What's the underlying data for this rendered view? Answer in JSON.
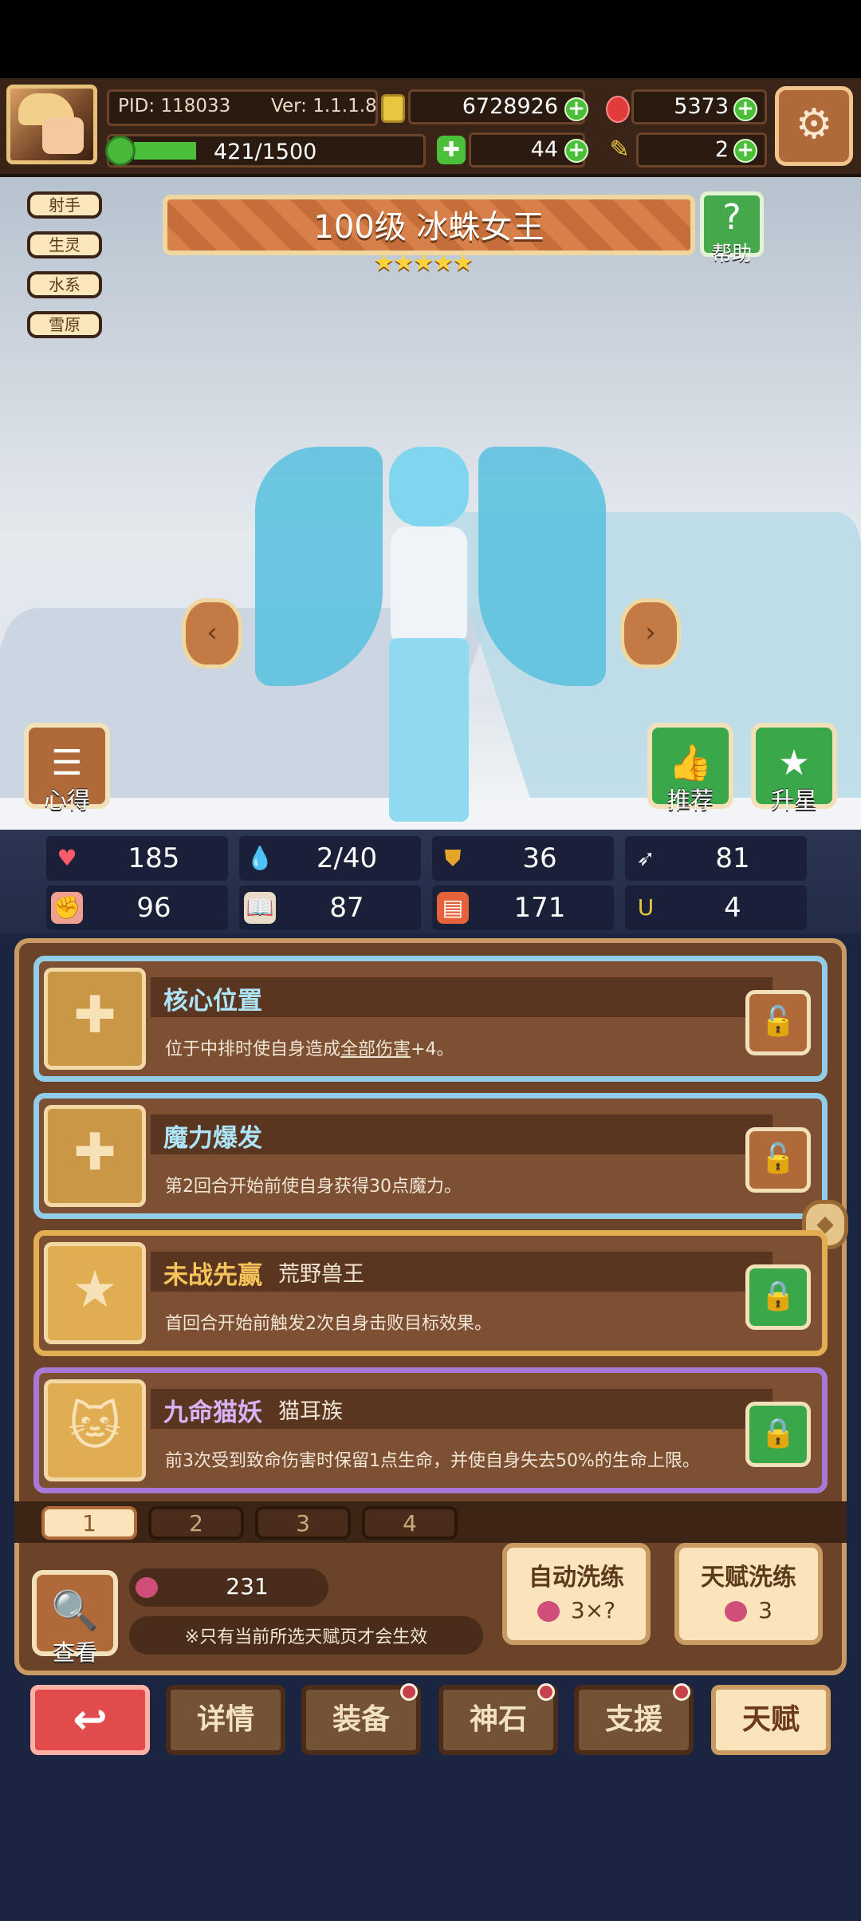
{
  "topbar": {
    "pid": "PID: 118033",
    "version": "Ver: 1.1.1.8",
    "gold": "6728926",
    "gems": "5373",
    "xp": "421/1500",
    "xp_fraction": 0.28,
    "clovers": "44",
    "keys": "2"
  },
  "hero": {
    "tags": [
      "射手",
      "生灵",
      "水系",
      "雪原"
    ],
    "title": "100级 冰蛛女王",
    "stars": "★★★★★",
    "help_label": "帮助",
    "xinde_label": "心得",
    "recommend_label": "推荐",
    "upstar_label": "升星"
  },
  "stats": [
    {
      "icon": "heart-icon",
      "value": "185"
    },
    {
      "icon": "water-drop-icon",
      "value": "2/40"
    },
    {
      "icon": "shield-icon",
      "value": "36"
    },
    {
      "icon": "wing-icon",
      "value": "81"
    },
    {
      "icon": "fist-icon",
      "value": "96"
    },
    {
      "icon": "book-icon",
      "value": "87"
    },
    {
      "icon": "scroll-icon",
      "value": "171"
    },
    {
      "icon": "horseshoe-icon",
      "value": "4"
    }
  ],
  "talents": [
    {
      "name": "核心位置",
      "sub": "",
      "desc_pre": "位于中排时使自身造成",
      "desc_link": "全部伤害",
      "desc_post": "+4。",
      "locked": false
    },
    {
      "name": "魔力爆发",
      "sub": "",
      "desc_pre": "第2回合开始前使自身获得30点魔力。",
      "desc_link": "",
      "desc_post": "",
      "locked": false
    },
    {
      "name": "未战先赢",
      "sub": "荒野兽王",
      "desc_pre": "首回合开始前触发2次自身击败目标效果。",
      "desc_link": "",
      "desc_post": "",
      "locked": true
    },
    {
      "name": "九命猫妖",
      "sub": "猫耳族",
      "desc_pre": "前3次受到致命伤害时保留1点生命，并使自身失去50%的生命上限。",
      "desc_link": "",
      "desc_post": "",
      "locked": true
    }
  ],
  "pages": [
    "1",
    "2",
    "3",
    "4"
  ],
  "bottom": {
    "view_label": "查看",
    "berry_count": "231",
    "note": "※只有当前所选天赋页才会生效",
    "auto_refine": "自动洗练",
    "auto_refine_cost": "3×?",
    "talent_refine": "天赋洗练",
    "talent_refine_cost": "3"
  },
  "nav": {
    "details": "详情",
    "equip": "装备",
    "stone": "神石",
    "support": "支援",
    "talent": "天赋"
  },
  "colors": {
    "wood": "#6b4329",
    "cyan_frame": "#8fcde8",
    "gold_frame": "#e3ad52",
    "purple_frame": "#a778d6",
    "green_button": "#3aa84a",
    "red_button": "#e14b4b"
  }
}
